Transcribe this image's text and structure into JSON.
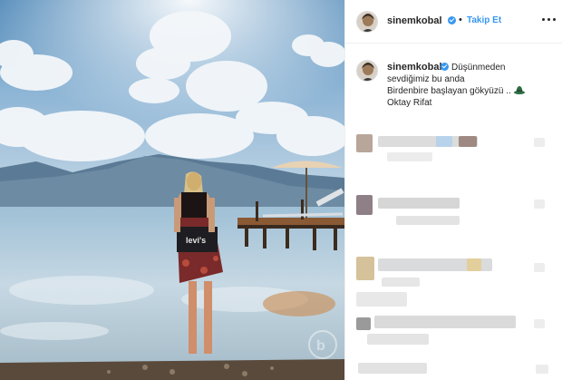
{
  "post": {
    "username": "sinemkobal",
    "follow_label": "Takip Et",
    "separator": "•"
  },
  "caption": {
    "lines": [
      "Düşünmeden",
      "sevdiğimiz bu anda",
      "Birdenbire başlayan gökyüzü ..",
      "Oktay Rifat"
    ]
  },
  "icons": {
    "verified": "verified-badge-icon",
    "more": "more-options-icon",
    "hat": "hat-emoji-icon",
    "watermark": "watermark-logo-icon"
  },
  "colors": {
    "accent": "#3897f0",
    "text": "#262626",
    "border": "#efefef"
  }
}
